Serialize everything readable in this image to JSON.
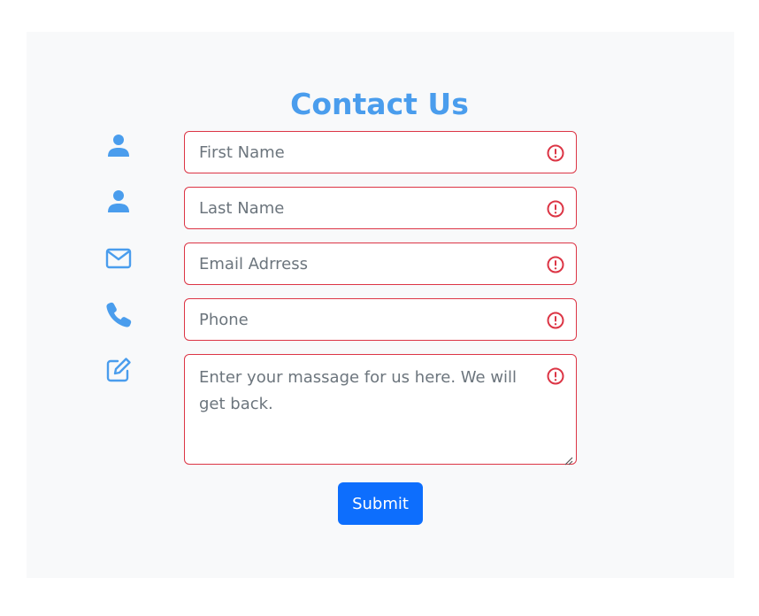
{
  "form": {
    "title": "Contact Us",
    "fields": [
      {
        "placeholder": "First Name",
        "icon": "person-icon"
      },
      {
        "placeholder": "Last Name",
        "icon": "person-icon"
      },
      {
        "placeholder": "Email Adrress",
        "icon": "envelope-icon"
      },
      {
        "placeholder": "Phone",
        "icon": "phone-icon"
      },
      {
        "placeholder": "Enter your massage for us here. We will get back.",
        "icon": "pencil-square-icon"
      }
    ],
    "submit_label": "Submit"
  },
  "colors": {
    "accent": "#4a9ded",
    "error": "#dc3545",
    "primary_button": "#0d6efd",
    "panel_background": "#f8f9fa"
  }
}
